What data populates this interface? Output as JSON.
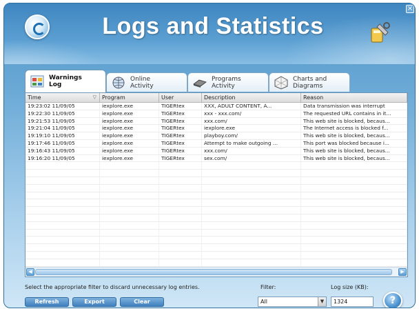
{
  "window": {
    "title": "Logs and Statistics",
    "close_glyph": "×"
  },
  "tabs": [
    {
      "label": "Warnings\nLog",
      "icon": "warnings-log-icon",
      "active": true
    },
    {
      "label": "Online\nActivity",
      "icon": "online-activity-icon",
      "active": false
    },
    {
      "label": "Programs\nActivity",
      "icon": "programs-activity-icon",
      "active": false
    },
    {
      "label": "Charts and\nDiagrams",
      "icon": "charts-icon",
      "active": false
    }
  ],
  "grid": {
    "columns": [
      "Time",
      "Program",
      "User",
      "Description",
      "Reason"
    ],
    "sort_glyph": "▽",
    "rows": [
      [
        "19:23:02 11/09/05",
        "iexplore.exe",
        "TIGERtex",
        "XXX, ADULT CONTENT, A...",
        "Data transmission was interrupt"
      ],
      [
        "19:22:30 11/09/05",
        "iexplore.exe",
        "TIGERtex",
        "xxx - xxx.com/",
        "The requested URL contains in it..."
      ],
      [
        "19:21:53 11/09/05",
        "iexplore.exe",
        "TIGERtex",
        "xxx.com/",
        "This web site is blocked, becaus..."
      ],
      [
        "19:21:04 11/09/05",
        "iexplore.exe",
        "TIGERtex",
        "iexplore.exe",
        "The Internet access is blocked f..."
      ],
      [
        "19:19:10 11/09/05",
        "iexplore.exe",
        "TIGERtex",
        "playboy.com/",
        "This web site is blocked, becaus..."
      ],
      [
        "19:17:46 11/09/05",
        "iexplore.exe",
        "TIGERtex",
        "Attempt to make outgoing ...",
        "This port was blocked because i..."
      ],
      [
        "19:16:43 11/09/05",
        "iexplore.exe",
        "TIGERtex",
        "xxx.com/",
        "This web site is blocked, becaus..."
      ],
      [
        "19:16:20 11/09/05",
        "iexplore.exe",
        "TIGERtex",
        "sex.com/",
        "This web site is blocked, becaus..."
      ]
    ],
    "empty_rows": 14
  },
  "scroll": {
    "left_glyph": "◀",
    "right_glyph": "▶"
  },
  "footer": {
    "hint": "Select the appropriate filter to discard unnecessary log entries.",
    "filter_label": "Filter:",
    "filter_value": "All",
    "dropdown_glyph": "▼",
    "logsize_label": "Log size (KB):",
    "logsize_value": "1324",
    "refresh_label": "Refresh",
    "export_label": "Export",
    "clear_label": "Clear",
    "help_glyph": "?"
  },
  "colors": {
    "accent": "#3e7fbd",
    "background_top": "#4f93c6",
    "background_bottom": "#cfe6f6"
  }
}
